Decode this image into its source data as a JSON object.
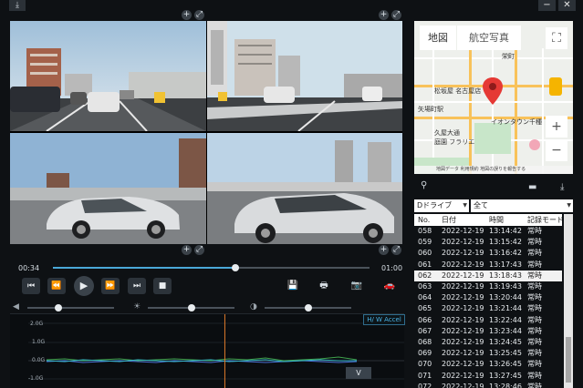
{
  "window": {
    "download_glyph": "⤓",
    "minimize_glyph": "−",
    "close_glyph": "✕"
  },
  "camera": {
    "zoom_glyph": "+",
    "expand_glyph": "⤢"
  },
  "player": {
    "current_time": "00:34",
    "total_time": "01:00",
    "progress": 0.577,
    "buttons": {
      "prev": "⏮",
      "rewind": "⏪",
      "play": "▶",
      "forward": "⏩",
      "step": "⏭",
      "stop": "■"
    },
    "tools": {
      "save": "💾",
      "print": "🖶",
      "snapshot": "📷",
      "car": "🚗"
    },
    "volume_level": 0.36,
    "brightness_level": 0.5,
    "contrast_level": 0.5
  },
  "graph": {
    "accel_button": "H/ W Accel",
    "y_labels": [
      "2.0G",
      "1.0G",
      "0.0G",
      "-1.0G"
    ],
    "v_button": "V",
    "cursor_position": 0.545
  },
  "map": {
    "tab_map": "地図",
    "tab_satellite": "航空写真",
    "fullscreen_glyph": "⛶",
    "zoom_in": "+",
    "zoom_out": "−",
    "labels": {
      "matsuzakaya": "松坂屋 名古屋店",
      "yaba": "矢場町駅",
      "aeon": "イオンタウン千種",
      "hisaya": "久屋大通",
      "ozeki": "庭園 フラリエ",
      "sakae": "栄町"
    },
    "footer": "地図データ  利用規約  地図の誤りを報告する"
  },
  "panel": {
    "location_glyph": "⚲",
    "folder_glyph": "▬",
    "download_glyph": "⤓",
    "drive_select": "Dドライブ",
    "filter_select": "全て"
  },
  "list": {
    "headers": {
      "no": "No.",
      "date": "日付",
      "time": "時間",
      "mode": "記録モード"
    },
    "rows": [
      {
        "no": "058",
        "date": "2022-12-19",
        "time": "13:14:42",
        "mode": "常時"
      },
      {
        "no": "059",
        "date": "2022-12-19",
        "time": "13:15:42",
        "mode": "常時"
      },
      {
        "no": "060",
        "date": "2022-12-19",
        "time": "13:16:42",
        "mode": "常時"
      },
      {
        "no": "061",
        "date": "2022-12-19",
        "time": "13:17:43",
        "mode": "常時"
      },
      {
        "no": "062",
        "date": "2022-12-19",
        "time": "13:18:43",
        "mode": "常時"
      },
      {
        "no": "063",
        "date": "2022-12-19",
        "time": "13:19:43",
        "mode": "常時"
      },
      {
        "no": "064",
        "date": "2022-12-19",
        "time": "13:20:44",
        "mode": "常時"
      },
      {
        "no": "065",
        "date": "2022-12-19",
        "time": "13:21:44",
        "mode": "常時"
      },
      {
        "no": "066",
        "date": "2022-12-19",
        "time": "13:22:44",
        "mode": "常時"
      },
      {
        "no": "067",
        "date": "2022-12-19",
        "time": "13:23:44",
        "mode": "常時"
      },
      {
        "no": "068",
        "date": "2022-12-19",
        "time": "13:24:45",
        "mode": "常時"
      },
      {
        "no": "069",
        "date": "2022-12-19",
        "time": "13:25:45",
        "mode": "常時"
      },
      {
        "no": "070",
        "date": "2022-12-19",
        "time": "13:26:45",
        "mode": "常時"
      },
      {
        "no": "071",
        "date": "2022-12-19",
        "time": "13:27:45",
        "mode": "常時"
      },
      {
        "no": "072",
        "date": "2022-12-19",
        "time": "13:28:46",
        "mode": "常時"
      }
    ],
    "selected_index": 4
  },
  "colors": {
    "accent": "#4aa8d8",
    "marker": "#e53935",
    "cursor": "#e07a2a"
  }
}
